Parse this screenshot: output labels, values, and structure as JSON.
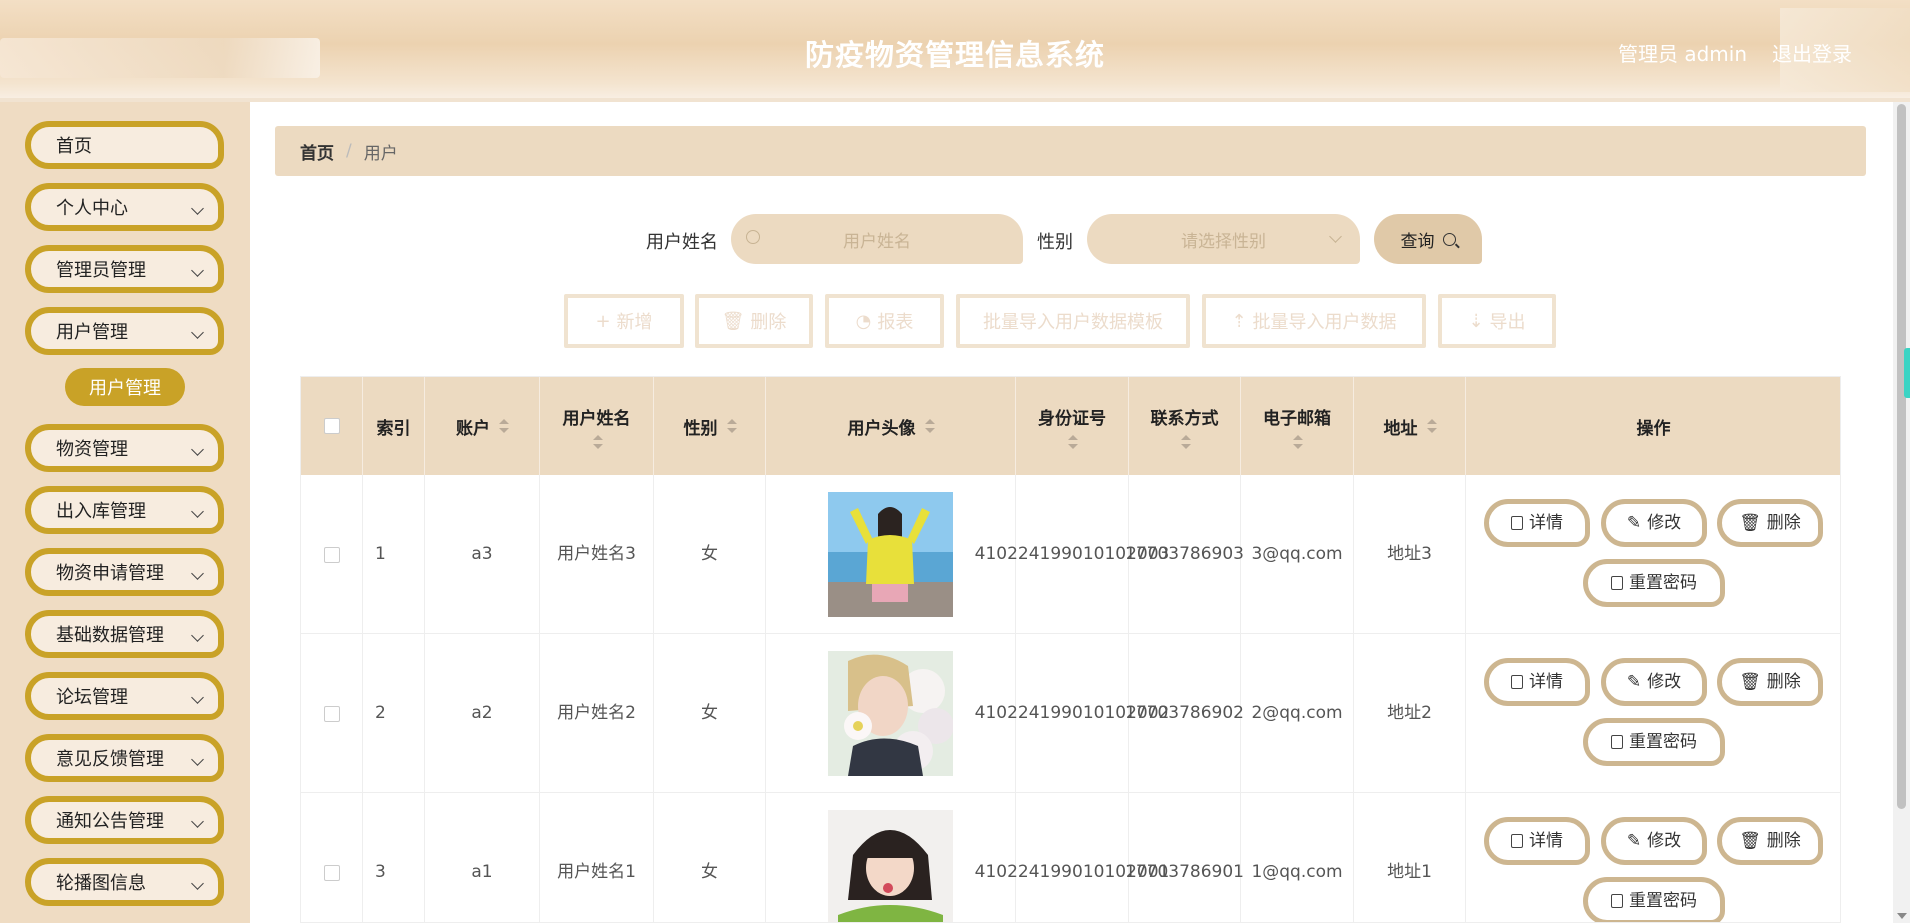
{
  "app": {
    "title": "防疫物资管理信息系统",
    "admin_label": "管理员 admin",
    "logout": "退出登录"
  },
  "sidebar": {
    "items": [
      {
        "label": "首页",
        "has_chevron": false
      },
      {
        "label": "个人中心",
        "has_chevron": true
      },
      {
        "label": "管理员管理",
        "has_chevron": true
      },
      {
        "label": "用户管理",
        "has_chevron": true
      },
      {
        "label": "物资管理",
        "has_chevron": true
      },
      {
        "label": "出入库管理",
        "has_chevron": true
      },
      {
        "label": "物资申请管理",
        "has_chevron": true
      },
      {
        "label": "基础数据管理",
        "has_chevron": true
      },
      {
        "label": "论坛管理",
        "has_chevron": true
      },
      {
        "label": "意见反馈管理",
        "has_chevron": true
      },
      {
        "label": "通知公告管理",
        "has_chevron": true
      },
      {
        "label": "轮播图信息",
        "has_chevron": true
      }
    ],
    "active_sub": "用户管理"
  },
  "breadcrumb": {
    "home": "首页",
    "separator": "/",
    "current": "用户"
  },
  "search": {
    "name_label": "用户姓名",
    "name_placeholder": "用户姓名",
    "gender_label": "性别",
    "gender_placeholder": "请选择性别",
    "query_label": "查询"
  },
  "actions": {
    "add": "新增",
    "delete": "删除",
    "report": "报表",
    "import_template": "批量导入用户数据模板",
    "import_data": "批量导入用户数据",
    "export": "导出"
  },
  "table": {
    "headers": {
      "index": "索引",
      "account": "账户",
      "name": "用户姓名",
      "gender": "性别",
      "avatar": "用户头像",
      "id_card": "身份证号",
      "phone": "联系方式",
      "email": "电子邮箱",
      "address": "地址",
      "ops": "操作"
    },
    "rows": [
      {
        "index": "1",
        "account": "a3",
        "name": "用户姓名3",
        "gender": "女",
        "id_card": "410224199010102003",
        "phone": "17703786903",
        "email": "3@qq.com",
        "address": "地址3",
        "avatar_desc": "photo-girl-yellow-sweater"
      },
      {
        "index": "2",
        "account": "a2",
        "name": "用户姓名2",
        "gender": "女",
        "id_card": "410224199010102002",
        "phone": "17703786902",
        "email": "2@qq.com",
        "address": "地址2",
        "avatar_desc": "photo-blonde-flowers"
      },
      {
        "index": "3",
        "account": "a1",
        "name": "用户姓名1",
        "gender": "女",
        "id_card": "410224199010102001",
        "phone": "17703786901",
        "email": "1@qq.com",
        "address": "地址1",
        "avatar_desc": "photo-girl-green-sweater"
      }
    ],
    "row_ops": {
      "detail": "详情",
      "edit": "修改",
      "delete": "删除",
      "reset_pwd": "重置密码"
    }
  },
  "colors": {
    "accent": "#c9a227",
    "header_bg": "#ecd2b0",
    "sidebar_bg": "#efdcc3",
    "panel_bg": "#ecdac1",
    "op_border": "#cdb690"
  }
}
